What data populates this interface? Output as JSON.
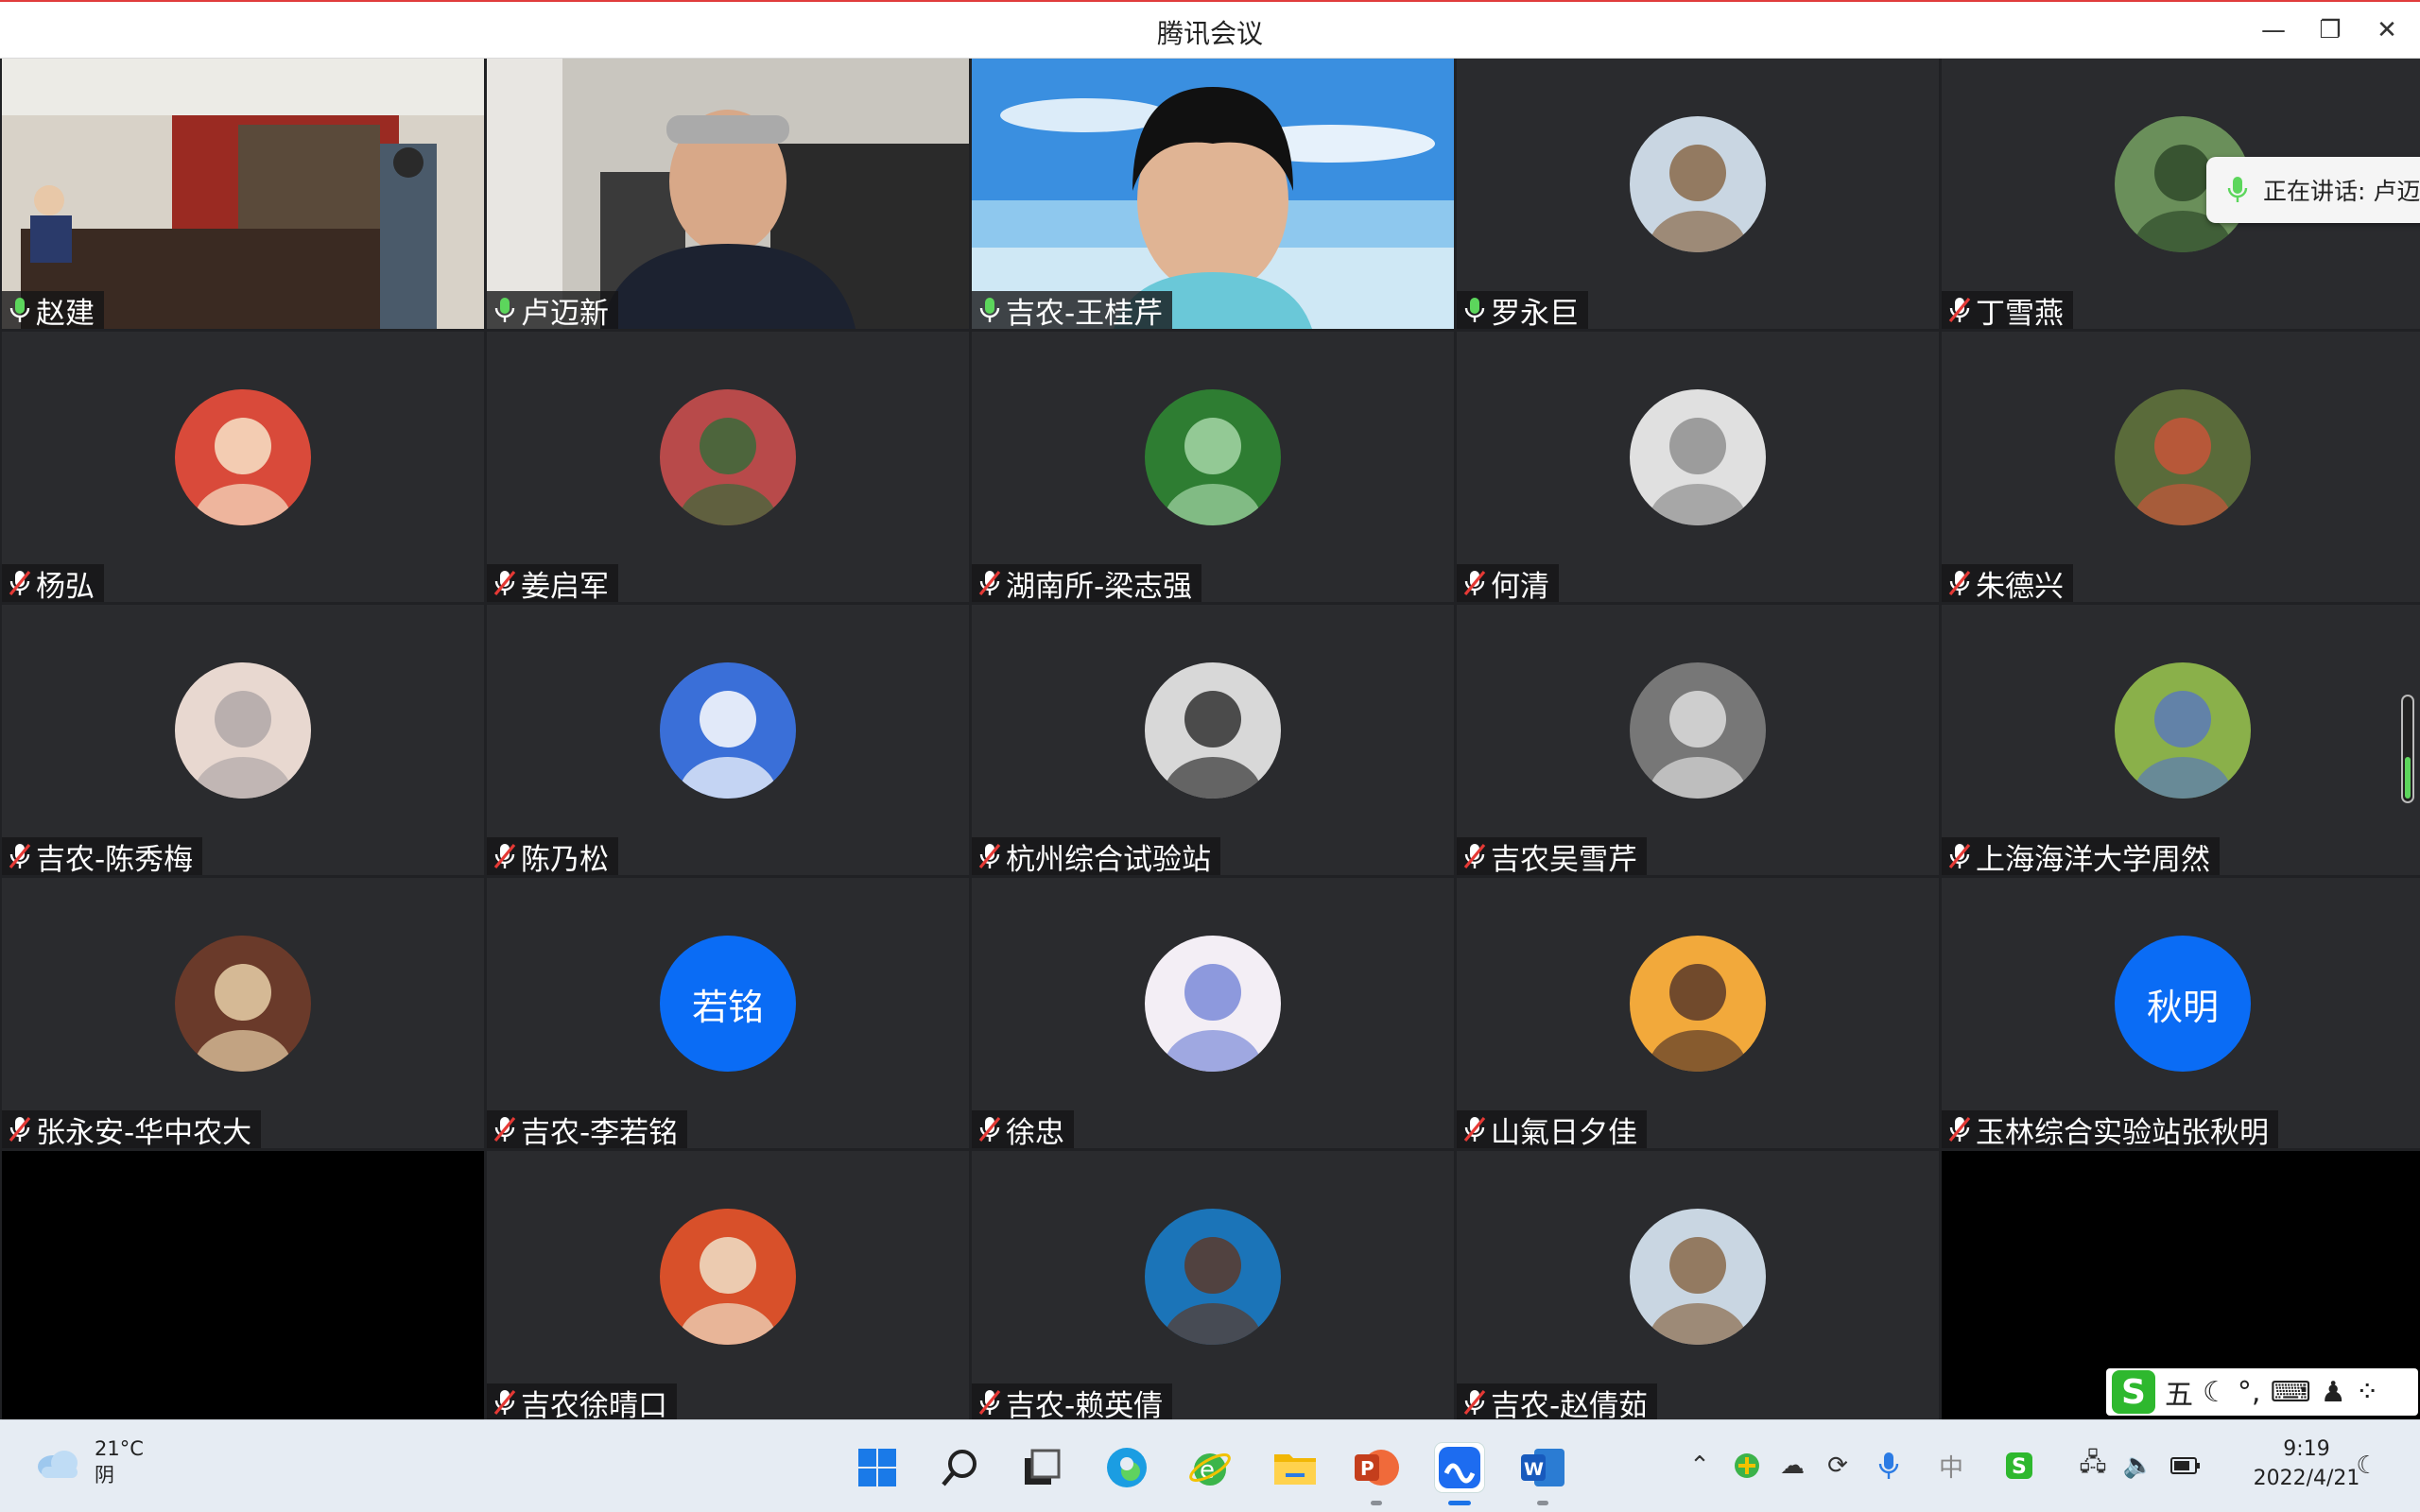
{
  "window": {
    "title": "腾讯会议",
    "minimize_label": "—",
    "maximize_label": "❐",
    "close_label": "✕"
  },
  "speaking_indicator": {
    "text": "正在讲话: 卢迈"
  },
  "participants": [
    {
      "name": "赵建",
      "mic": "on",
      "kind": "video-office"
    },
    {
      "name": "卢迈新",
      "mic": "on",
      "kind": "video-man"
    },
    {
      "name": "吉农-王桂芹",
      "mic": "on",
      "kind": "video-beach"
    },
    {
      "name": "罗永巨",
      "mic": "on",
      "kind": "avatar-photo"
    },
    {
      "name": "丁雪燕",
      "mic": "muted",
      "kind": "avatar-photo"
    },
    {
      "name": "杨弘",
      "mic": "muted",
      "kind": "avatar-photo"
    },
    {
      "name": "姜启军",
      "mic": "muted",
      "kind": "avatar-photo"
    },
    {
      "name": "湖南所-梁志强",
      "mic": "muted",
      "kind": "avatar-photo"
    },
    {
      "name": "何清",
      "mic": "muted",
      "kind": "avatar-photo"
    },
    {
      "name": "朱德兴",
      "mic": "muted",
      "kind": "avatar-photo"
    },
    {
      "name": "吉农-陈秀梅",
      "mic": "muted",
      "kind": "avatar-photo"
    },
    {
      "name": "陈乃松",
      "mic": "muted",
      "kind": "avatar-photo"
    },
    {
      "name": "杭州综合试验站",
      "mic": "muted",
      "kind": "avatar-photo"
    },
    {
      "name": "吉农吴雪芹",
      "mic": "muted",
      "kind": "avatar-photo"
    },
    {
      "name": "上海海洋大学周然",
      "mic": "muted",
      "kind": "avatar-photo"
    },
    {
      "name": "张永安-华中农大",
      "mic": "muted",
      "kind": "avatar-photo"
    },
    {
      "name": "吉农-李若铭",
      "mic": "muted",
      "kind": "avatar-initials",
      "initials": "若铭"
    },
    {
      "name": "徐忠",
      "mic": "muted",
      "kind": "avatar-photo"
    },
    {
      "name": "山氣日夕佳",
      "mic": "muted",
      "kind": "avatar-photo"
    },
    {
      "name": "玉林综合实验站张秋明",
      "mic": "muted",
      "kind": "avatar-initials",
      "initials": "秋明"
    },
    {
      "name": "",
      "mic": "none",
      "kind": "empty"
    },
    {
      "name": "吉农徐晴口",
      "mic": "muted",
      "kind": "avatar-photo"
    },
    {
      "name": "吉农-赖英倩",
      "mic": "muted",
      "kind": "avatar-photo"
    },
    {
      "name": "吉农-赵倩茹",
      "mic": "muted",
      "kind": "avatar-photo"
    },
    {
      "name": "",
      "mic": "none",
      "kind": "empty"
    }
  ],
  "ime": {
    "mode_label": "五",
    "punct_label": "°,"
  },
  "taskbar": {
    "weather_temp": "21°C",
    "weather_cond": "阴",
    "time": "9:19",
    "date": "2022/4/21"
  },
  "colors": {
    "tile_bg": "#2a2b2e",
    "avatar_blue": "#0a6cf5",
    "mic_on": "#5cd65c",
    "mic_muted": "#e53935"
  }
}
